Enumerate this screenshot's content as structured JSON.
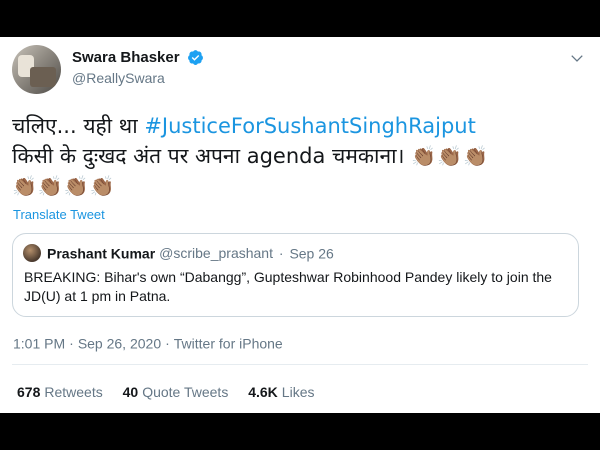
{
  "author": {
    "display_name": "Swara Bhasker",
    "handle": "@ReallySwara",
    "verified_icon": "verified-badge-icon"
  },
  "tweet": {
    "text_prefix": "चलिए... यही था ",
    "hashtag": "#JusticeForSushantSinghRajput",
    "text_line2": "किसी के दुःखद अंत पर अपना agenda चमकाना। ",
    "claps_line2": "👏🏽👏🏽👏🏽",
    "claps_line3": "👏🏽👏🏽👏🏽👏🏽",
    "translate_label": "Translate Tweet"
  },
  "quoted_tweet": {
    "display_name": "Prashant Kumar",
    "handle": "@scribe_prashant",
    "separator": "·",
    "date": "Sep 26",
    "text": "BREAKING: Bihar's own “Dabangg”, Gupteshwar Robinhood Pandey likely to join the JD(U) at 1 pm in Patna."
  },
  "meta": {
    "time": "1:01 PM",
    "separator": "·",
    "date": "Sep 26, 2020",
    "source": "Twitter for iPhone"
  },
  "stats": {
    "retweets_count": "678",
    "retweets_label": "Retweets",
    "quotes_count": "40",
    "quotes_label": "Quote Tweets",
    "likes_count": "4.6K",
    "likes_label": "Likes"
  },
  "colors": {
    "link": "#1b95e0",
    "text": "#14171a",
    "secondary": "#657786",
    "border": "#ccd6dd",
    "verified": "#1da1f2"
  }
}
